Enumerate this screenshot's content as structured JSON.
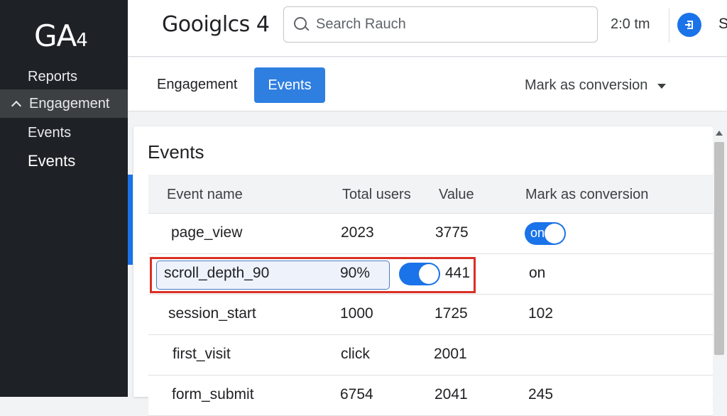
{
  "sidebar": {
    "logo_main": "GA",
    "logo_sub": "4",
    "items": [
      {
        "label": "Reports"
      },
      {
        "label": "Engagement"
      },
      {
        "label": "Events"
      },
      {
        "label": "Events"
      }
    ]
  },
  "topbar": {
    "title": "Gooiglcs 4",
    "search_placeholder": "Search Rauch",
    "time": "2:0 tm",
    "account_icon": "account-switch-icon",
    "account_initial": "S"
  },
  "subbar": {
    "tab_engagement": "Engagement",
    "tab_events": "Events",
    "mark_dropdown": "Mark as conversion"
  },
  "card": {
    "title": "Events",
    "columns": [
      "Event name",
      "Total users",
      "Value",
      "Mark as conversion"
    ],
    "rows": [
      {
        "name": "page_view",
        "users": "2023",
        "value": "3775",
        "conv": "on"
      },
      {
        "name": "scroll_depth_90",
        "users": "90%",
        "value": "441",
        "conv": "on"
      },
      {
        "name": "session_start",
        "users": "1000",
        "value": "1725",
        "conv": "102"
      },
      {
        "name": "first_visit",
        "users": "click",
        "value": "2001",
        "conv": ""
      },
      {
        "name": "form_submit",
        "users": "6754",
        "value": "2041",
        "conv": "245"
      }
    ]
  },
  "colors": {
    "accent": "#1a73e8",
    "sidebar_bg": "#1e2126",
    "highlight_frame": "#d93025"
  }
}
